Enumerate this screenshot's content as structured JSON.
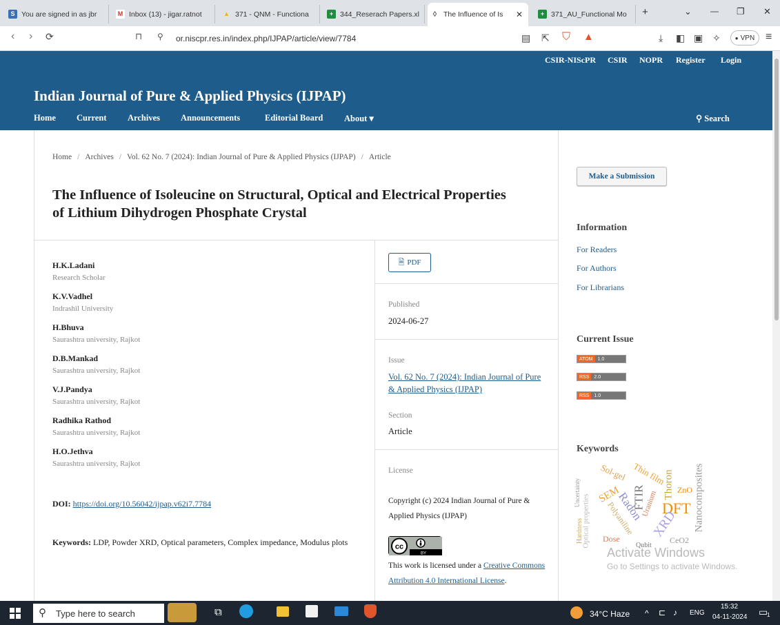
{
  "browser": {
    "tabs": [
      {
        "label": "You are signed in as jbr",
        "icon_color": "#3b6fb6",
        "icon_glyph": "S"
      },
      {
        "label": "Inbox (13) - jigar.ratnot",
        "icon_color": "#ffffff",
        "icon_glyph": "M"
      },
      {
        "label": "371 - QNM - Functiona",
        "icon_color": "#f4b400",
        "icon_glyph": "▲"
      },
      {
        "label": "344_Reserach Papers.xl",
        "icon_color": "#1e8e3e",
        "icon_glyph": "+"
      },
      {
        "label": "The Influence of Is",
        "icon_color": "#e8eaed",
        "icon_glyph": "◊",
        "active": true
      },
      {
        "label": "371_AU_Functional Mo",
        "icon_color": "#1e8e3e",
        "icon_glyph": "+"
      }
    ],
    "new_tab": "+",
    "window_controls": {
      "dropdown": "⌄",
      "minimize": "—",
      "restore": "❐",
      "close": "✕"
    },
    "nav": {
      "back": "‹",
      "forward": "›",
      "reload": "⟳",
      "bookmark": "⊓",
      "site_info": "⚲"
    },
    "url": "or.niscpr.res.in/index.php/IJPAP/article/view/7784",
    "toolbar_icons": [
      "reader-icon",
      "share-icon",
      "brave-shield-icon",
      "rewards-icon",
      "download-icon",
      "sidebar-icon",
      "wallet-icon",
      "extension-icon"
    ],
    "vpn_label": "VPN",
    "menu": "≡"
  },
  "site": {
    "top_links": [
      "CSIR-NIScPR",
      "CSIR",
      "NOPR",
      "Register",
      "Login"
    ],
    "title": "Indian Journal of Pure & Applied Physics (IJPAP)",
    "nav": [
      "Home",
      "Current",
      "Archives",
      "Announcements",
      "Editorial Board",
      "About ▾"
    ],
    "search_label": "Search",
    "header_color": "#1e5c8c"
  },
  "breadcrumb": [
    "Home",
    "Archives",
    "Vol. 62 No. 7 (2024): Indian Journal of Pure & Applied Physics (IJPAP)",
    "Article"
  ],
  "article": {
    "title": "The Influence of Isoleucine on Structural, Optical and Electrical Properties of Lithium Dihydrogen Phosphate Crystal",
    "authors": [
      {
        "name": "H.K.Ladani",
        "affiliation": "Research Scholar"
      },
      {
        "name": "K.V.Vadhel",
        "affiliation": "Indrashil University"
      },
      {
        "name": "H.Bhuva",
        "affiliation": "Saurashtra university, Rajkot"
      },
      {
        "name": "D.B.Mankad",
        "affiliation": "Saurashtra university, Rajkot"
      },
      {
        "name": "V.J.Pandya",
        "affiliation": "Saurashtra university, Rajkot"
      },
      {
        "name": "Radhika Rathod",
        "affiliation": "Saurashtra university, Rajkot"
      },
      {
        "name": "H.O.Jethva",
        "affiliation": "Saurashtra university, Rajkot"
      }
    ],
    "doi_label": "DOI:",
    "doi": "https://doi.org/10.56042/ijpap.v62i7.7784",
    "keywords_label": "Keywords:",
    "keywords": "LDP, Powder XRD, Optical parameters, Complex impedance, Modulus plots"
  },
  "meta": {
    "pdf_label": "PDF",
    "published_label": "Published",
    "published_date": "2024-06-27",
    "issue_label": "Issue",
    "issue_value": "Vol. 62 No. 7 (2024): Indian Journal of Pure & Applied Physics (IJPAP)",
    "section_label": "Section",
    "section_value": "Article",
    "license_label": "License",
    "copyright": "Copyright (c) 2024 Indian Journal of Pure & Applied Physics (IJPAP)",
    "license_prefix": "This work is licensed under a ",
    "license_link": "Creative Commons Attribution 4.0 International License",
    "license_suffix": "."
  },
  "sidebar": {
    "submit_label": "Make a Submission",
    "information_heading": "Information",
    "information_links": [
      "For Readers",
      "For Authors",
      "For Librarians"
    ],
    "current_issue_heading": "Current Issue",
    "feeds": [
      {
        "left": "ATOM",
        "right": "1.0"
      },
      {
        "left": "RSS",
        "right": "2.0"
      },
      {
        "left": "RSS",
        "right": "1.0"
      }
    ],
    "keywords_heading": "Keywords",
    "cloud": [
      "Sol-gel",
      "Thin film",
      "Thoron",
      "Nanocomposites",
      "ZnO",
      "SEM",
      "FTIR",
      "Radon",
      "Uranium",
      "DFT",
      "Polyaniline",
      "XRD",
      "Dose",
      "Qubit",
      "CeO2",
      "Hardness",
      "Uncertainty",
      "Optical properties"
    ]
  },
  "watermark": {
    "line1": "Activate Windows",
    "line2": "Go to Settings to activate Windows."
  },
  "taskbar": {
    "search_placeholder": "Type here to search",
    "weather": "34°C Haze",
    "language": "ENG",
    "time": "15:32",
    "date": "04-11-2024",
    "notification_count": "1"
  }
}
